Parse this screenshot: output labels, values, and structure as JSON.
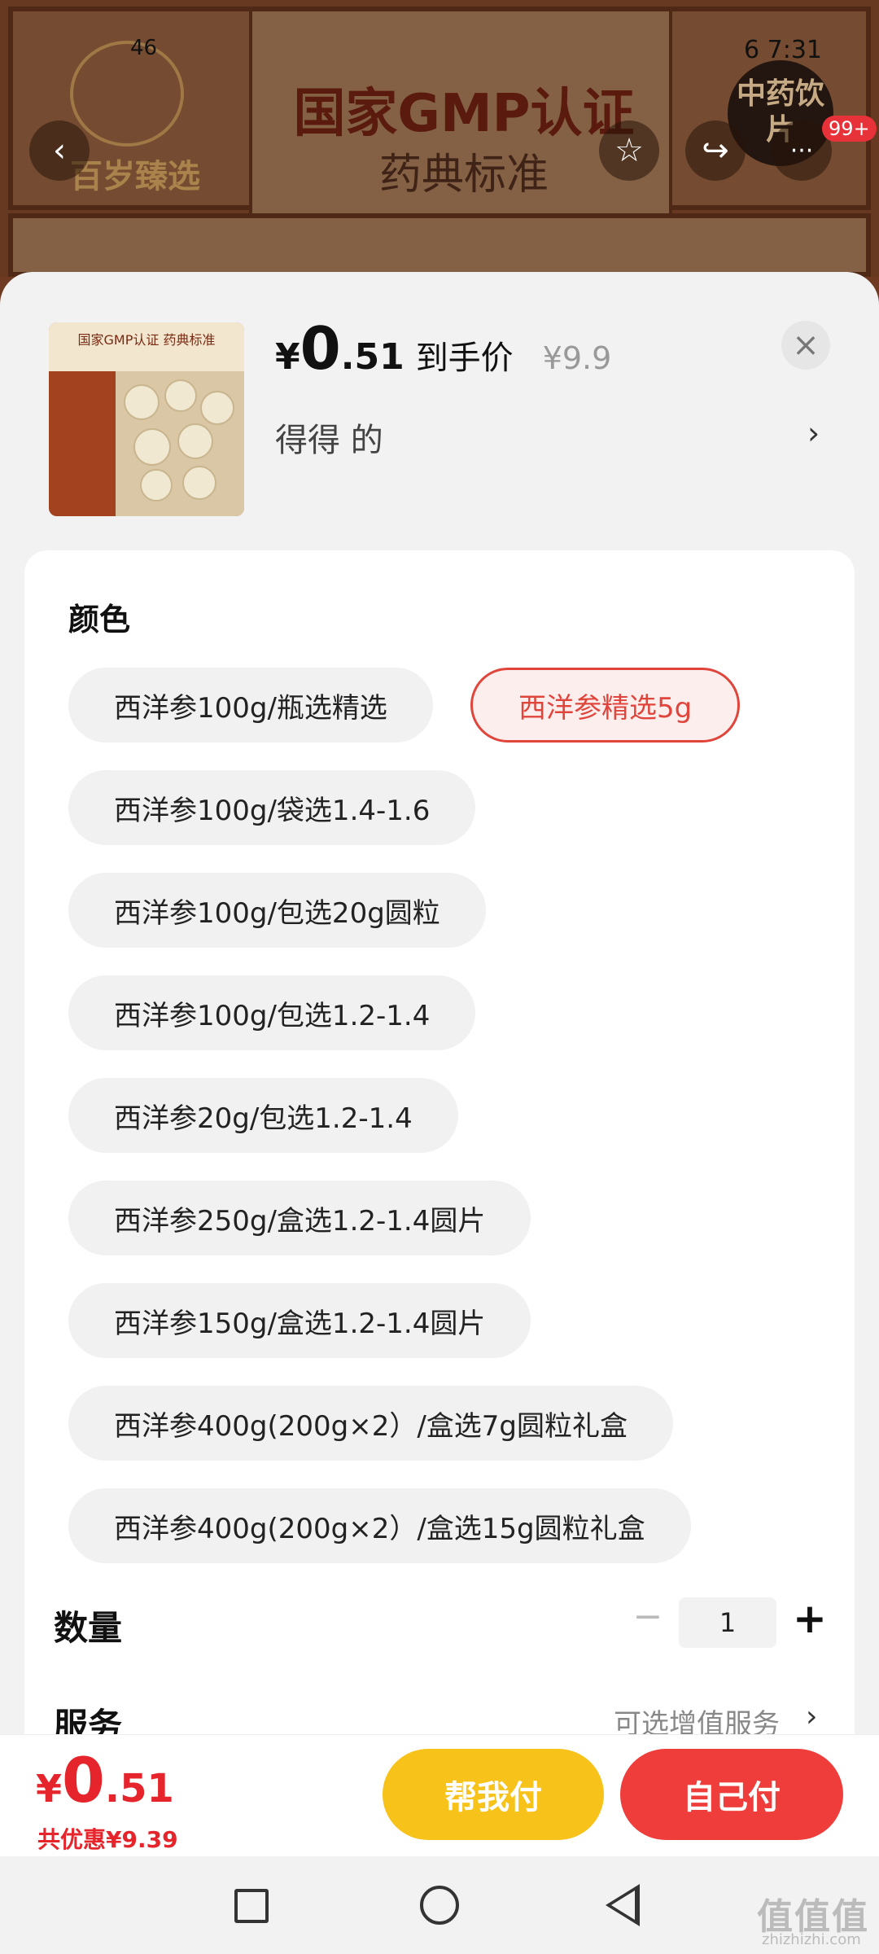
{
  "status_bar": {
    "network": "46",
    "time": "7:31",
    "battery": "6"
  },
  "banner": {
    "brand": "百岁臻选",
    "title": "国家GMP认证",
    "subtitle": "药典标准",
    "seal": "中药饮片"
  },
  "top_nav": {
    "back_icon": "‹",
    "favorite_icon": "☆",
    "share_icon": "↪",
    "more_icon": "···",
    "more_badge": "99+"
  },
  "product": {
    "price_currency": "¥",
    "price_integer": "0",
    "price_decimal": ".51",
    "price_label": "到手价",
    "original_price": "¥9.9",
    "subtitle": "得得  的",
    "thumb_header": "国家GMP认证 药典标准"
  },
  "sections": {
    "color_title": "颜色",
    "quantity_title": "数量",
    "service_title": "服务",
    "service_hint": "可选增值服务"
  },
  "options": [
    {
      "label": "西洋参100g/瓶选精选",
      "selected": false
    },
    {
      "label": "西洋参精选5g",
      "selected": true
    },
    {
      "label": "西洋参100g/袋选1.4-1.6",
      "selected": false
    },
    {
      "label": "西洋参100g/包选20g圆粒",
      "selected": false
    },
    {
      "label": "西洋参100g/包选1.2-1.4",
      "selected": false
    },
    {
      "label": "西洋参20g/包选1.2-1.4",
      "selected": false
    },
    {
      "label": "西洋参250g/盒选1.2-1.4圆片",
      "selected": false
    },
    {
      "label": "西洋参150g/盒选1.2-1.4圆片",
      "selected": false
    },
    {
      "label": "西洋参400g(200g×2）/盒选7g圆粒礼盒",
      "selected": false
    },
    {
      "label": "西洋参400g(200g×2）/盒选15g圆粒礼盒",
      "selected": false
    }
  ],
  "quantity": {
    "minus": "−",
    "value": "1",
    "plus": "+"
  },
  "checkout": {
    "currency": "¥",
    "integer": "0",
    "decimal": ".51",
    "discount": "共优惠¥9.39",
    "help_pay": "帮我付",
    "self_pay": "自己付"
  },
  "watermark": {
    "main": "值值值",
    "sub": "zhizhizhi.com"
  },
  "colors": {
    "accent_red": "#e5252b",
    "accent_yellow": "#f7c21a",
    "selected_border": "#e0453c"
  }
}
